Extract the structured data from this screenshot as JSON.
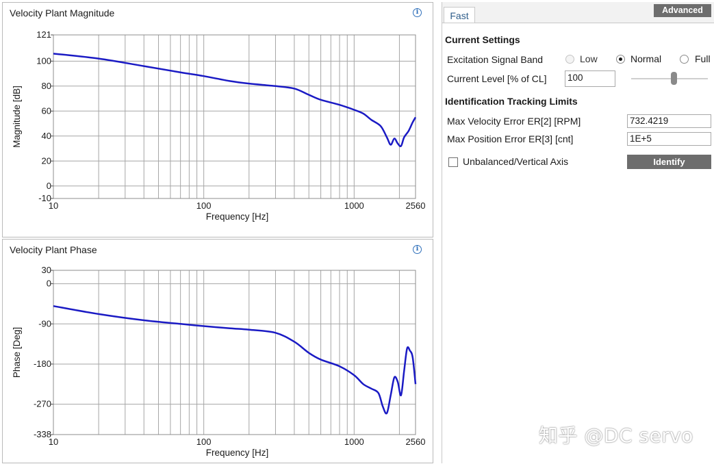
{
  "magnitude_panel": {
    "title": "Velocity Plant Magnitude",
    "info_icon": "info-icon"
  },
  "phase_panel": {
    "title": "Velocity Plant Phase",
    "info_icon": "info-icon"
  },
  "chart_data": [
    {
      "type": "line",
      "xscale": "log",
      "xlim": [
        10,
        2560
      ],
      "ylim": [
        -10,
        121
      ],
      "xlabel": "Frequency [Hz]",
      "ylabel": "Magnitude [dB]",
      "xtick_labels": [
        "10",
        "100",
        "1000",
        "2560"
      ],
      "xtick_values": [
        10,
        100,
        1000,
        2560
      ],
      "ytick_labels": [
        "121",
        "100",
        "80",
        "60",
        "40",
        "20",
        "0",
        "-10"
      ],
      "ytick_values": [
        121,
        100,
        80,
        60,
        40,
        20,
        0,
        -10
      ],
      "grid": true,
      "line_color": "#1a1ac4",
      "series": [
        {
          "x": [
            10,
            20,
            40,
            70,
            100,
            150,
            200,
            300,
            400,
            500,
            600,
            800,
            1000,
            1150,
            1300,
            1500,
            1650,
            1750,
            1850,
            1950,
            2050,
            2150,
            2300,
            2450,
            2560
          ],
          "y": [
            106,
            102,
            96,
            91,
            88,
            84,
            82,
            80,
            78,
            73,
            69,
            65,
            61,
            58,
            53,
            48,
            39,
            33,
            38,
            34,
            32,
            39,
            44,
            51,
            55
          ]
        }
      ]
    },
    {
      "type": "line",
      "xscale": "log",
      "xlim": [
        10,
        2560
      ],
      "ylim": [
        -338,
        30
      ],
      "xlabel": "Frequency [Hz]",
      "ylabel": "Phase [Deg]",
      "xtick_labels": [
        "10",
        "100",
        "1000",
        "2560"
      ],
      "xtick_values": [
        10,
        100,
        1000,
        2560
      ],
      "ytick_labels": [
        "30",
        "0",
        "-90",
        "-180",
        "-270",
        "-338"
      ],
      "ytick_values": [
        30,
        0,
        -90,
        -180,
        -270,
        -338
      ],
      "grid": true,
      "line_color": "#1a1ac4",
      "series": [
        {
          "x": [
            10,
            20,
            40,
            70,
            100,
            150,
            200,
            300,
            400,
            500,
            600,
            800,
            1000,
            1150,
            1300,
            1450,
            1550,
            1650,
            1750,
            1850,
            1950,
            2050,
            2150,
            2250,
            2350,
            2450,
            2560
          ],
          "y": [
            -50,
            -68,
            -82,
            -90,
            -95,
            -100,
            -103,
            -110,
            -130,
            -155,
            -170,
            -185,
            -205,
            -225,
            -235,
            -245,
            -275,
            -290,
            -250,
            -210,
            -220,
            -250,
            -195,
            -145,
            -150,
            -165,
            -225
          ]
        }
      ]
    }
  ],
  "right_panel": {
    "tab_label": "Fast",
    "advanced_label": "Advanced",
    "current_settings_title": "Current Settings",
    "excitation_label": "Excitation Signal Band",
    "excitation_options": [
      {
        "label": "Low",
        "state": "disabled"
      },
      {
        "label": "Normal",
        "state": "checked"
      },
      {
        "label": "Full",
        "state": "unchecked"
      }
    ],
    "current_level_label": "Current Level [% of CL]",
    "current_level_value": "100",
    "current_level_slider": 0.55,
    "tracking_title": "Identification Tracking Limits",
    "max_velocity_label": "Max Velocity Error ER[2] [RPM]",
    "max_velocity_value": "732.4219",
    "max_position_label": "Max Position Error ER[3] [cnt]",
    "max_position_value": "1E+5",
    "unbalanced_label": "Unbalanced/Vertical Axis",
    "unbalanced_checked": false,
    "identify_label": "Identify"
  },
  "watermark": "知乎 @DC servo"
}
